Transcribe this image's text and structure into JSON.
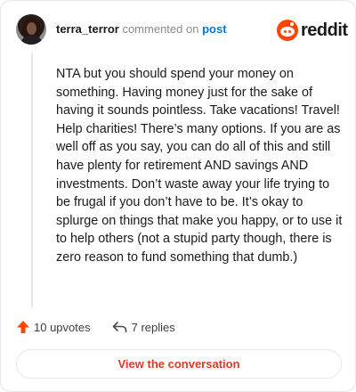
{
  "comment": {
    "username": "terra_terror",
    "action_text": "commented on",
    "target_link": "post",
    "body": "NTA but you should spend your money on something. Having money just for the sake of having it sounds pointless. Take vacations! Travel! Help charities! There’s many options. If you are as well off as you say, you can do all of this and still have plenty for retirement AND savings AND investments. Don’t waste away your life trying to be frugal if you don’t have to be. It’s okay to splurge on things that make you happy, or to use it to help others (not a stupid party though, there is zero reason to fund something that dumb.)"
  },
  "brand": {
    "name": "reddit",
    "color": "#ff4500"
  },
  "actions": {
    "upvotes": "10 upvotes",
    "replies": "7 replies"
  },
  "cta": {
    "label": "View the conversation",
    "color": "#e0391f"
  }
}
